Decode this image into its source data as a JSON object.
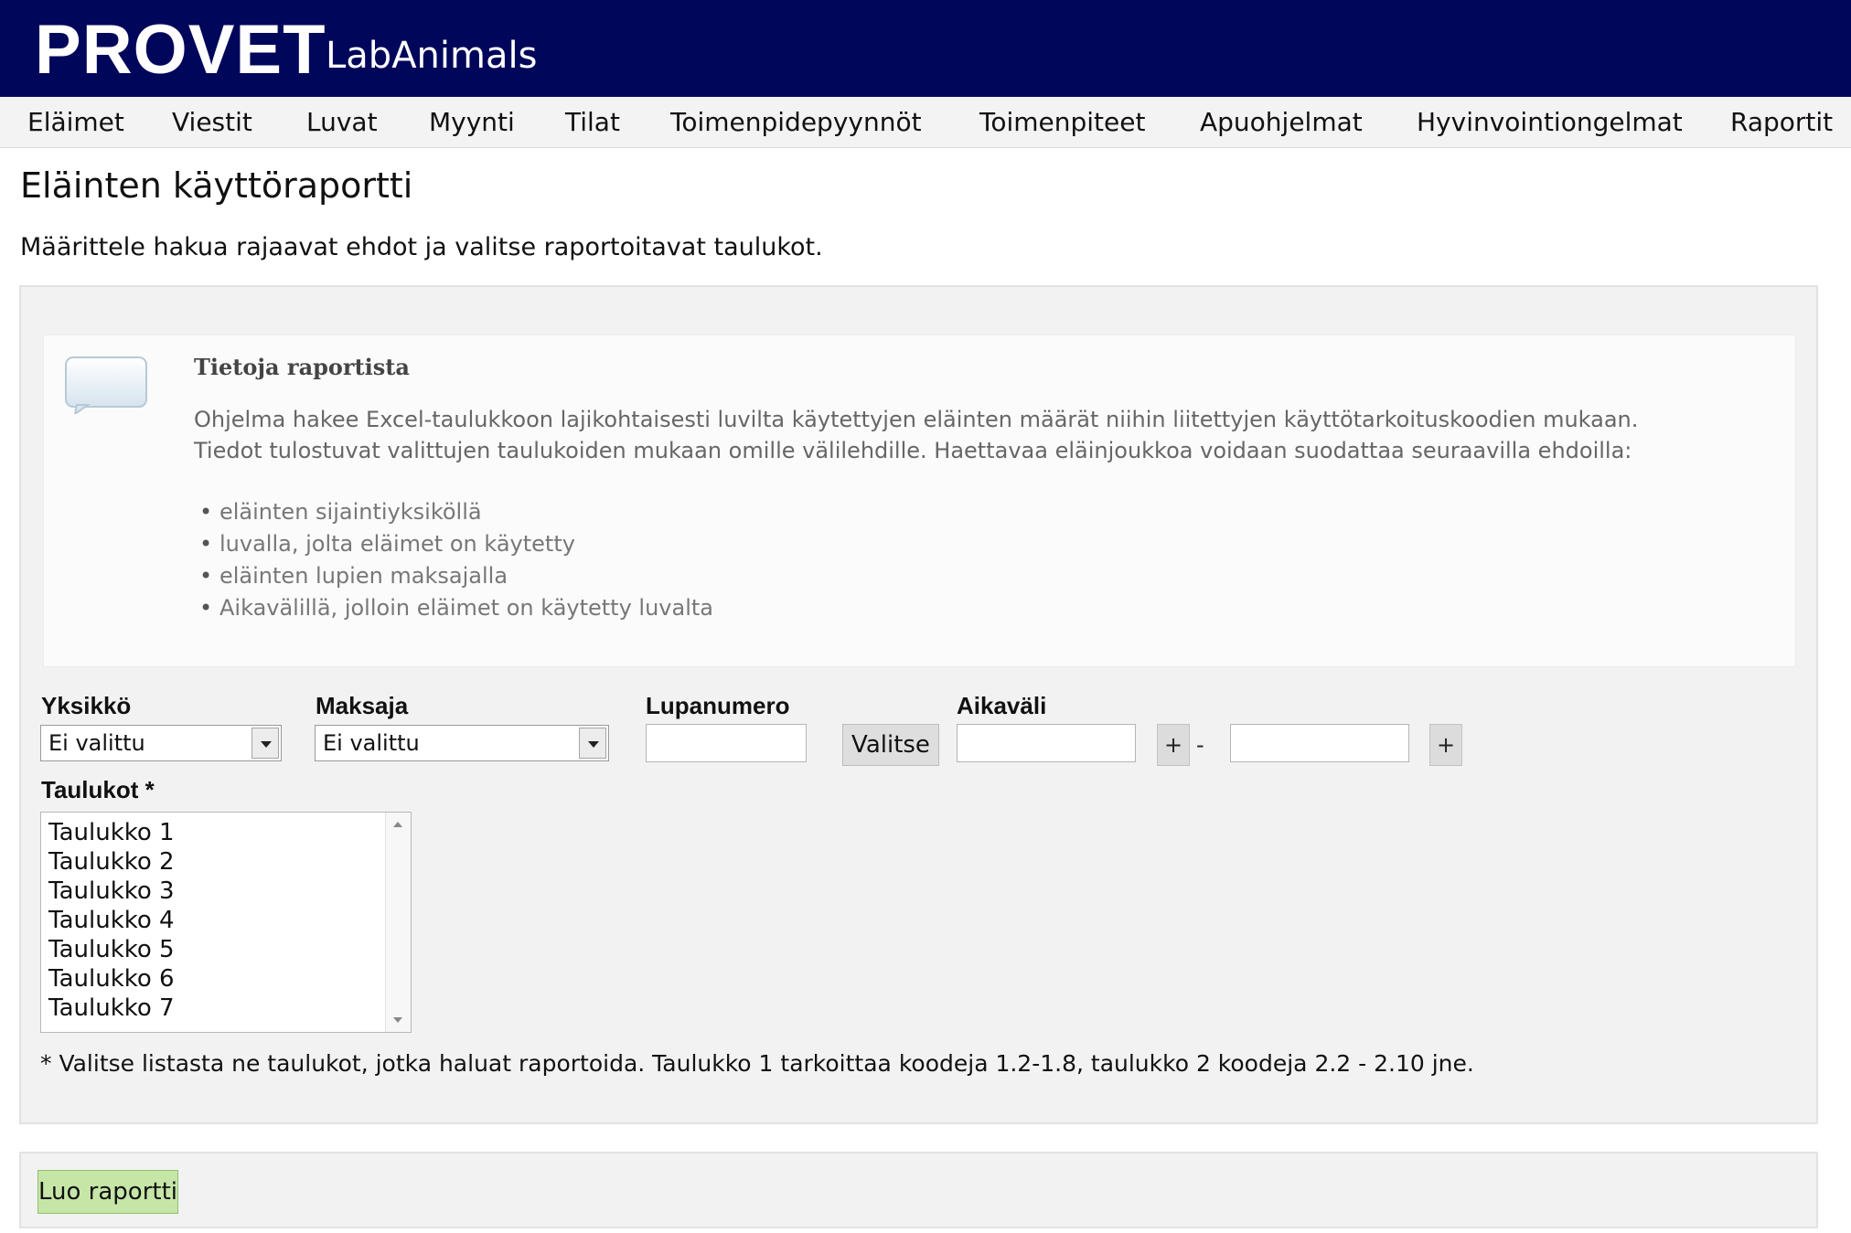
{
  "header": {
    "brand": "PROVET",
    "product": "LabAnimals"
  },
  "nav": {
    "items": [
      "Eläimet",
      "Viestit",
      "Luvat",
      "Myynti",
      "Tilat",
      "Toimenpidepyynnöt",
      "Toimenpiteet",
      "Apuohjelmat",
      "Hyvinvointiongelmat",
      "Raportit"
    ]
  },
  "page": {
    "title": "Eläinten käyttöraportti",
    "intro": "Määrittele hakua rajaavat ehdot ja valitse raportoitavat taulukot."
  },
  "info": {
    "title": "Tietoja raportista",
    "line1": "Ohjelma hakee Excel-taulukkoon lajikohtaisesti luvilta käytettyjen eläinten määrät niihin liitettyjen käyttötarkoituskoodien mukaan.",
    "line2": "Tiedot tulostuvat valittujen taulukoiden mukaan omille välilehdille. Haettavaa eläinjoukkoa voidaan suodattaa seuraavilla ehdoilla:",
    "bullets": [
      "eläinten sijaintiyksiköllä",
      "luvalla, jolta eläimet on käytetty",
      "eläinten lupien maksajalla",
      "Aikavälillä, jolloin eläimet on käytetty luvalta"
    ],
    "icon": "speech-bubble-icon"
  },
  "form": {
    "unit": {
      "label": "Yksikkö",
      "value": "Ei valittu"
    },
    "payer": {
      "label": "Maksaja",
      "value": "Ei valittu"
    },
    "permit": {
      "label": "Lupanumero",
      "value": "",
      "button": "Valitse"
    },
    "period": {
      "label": "Aikaväli",
      "start": "",
      "end": "",
      "picker": "+",
      "separator": "-"
    },
    "tables": {
      "label": "Taulukot *",
      "items": [
        "Taulukko 1",
        "Taulukko 2",
        "Taulukko 3",
        "Taulukko 4",
        "Taulukko 5",
        "Taulukko 6",
        "Taulukko 7"
      ]
    },
    "footnote": "* Valitse listasta ne taulukot, jotka haluat raportoida. Taulukko 1 tarkoittaa koodeja 1.2-1.8, taulukko 2 koodeja 2.2 - 2.10 jne."
  },
  "actions": {
    "create": "Luo raportti"
  },
  "colors": {
    "header_bg": "#00065a",
    "nav_bg": "#f3f3f3",
    "panel_bg": "#f2f2f2",
    "create_button": "#c6e6a8"
  }
}
